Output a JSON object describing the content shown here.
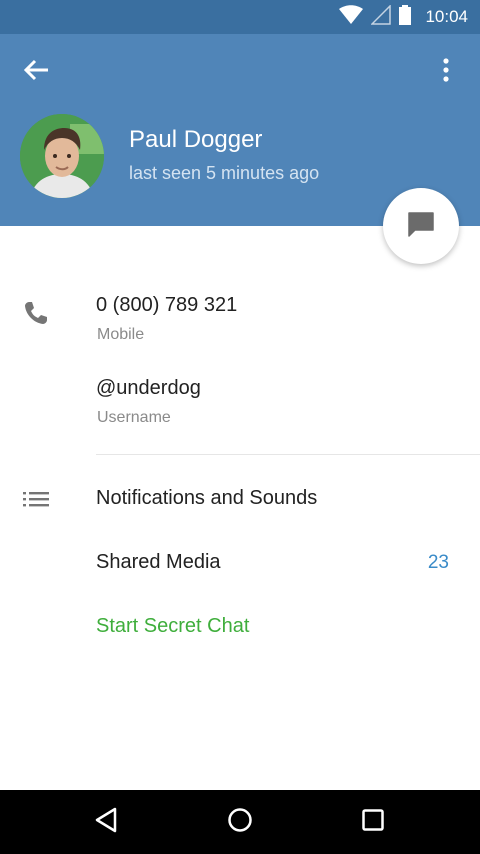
{
  "status_bar": {
    "time": "10:04",
    "icons": [
      "wifi-icon",
      "signal-icon",
      "battery-icon"
    ]
  },
  "header": {
    "back_icon": "arrow-left-icon",
    "menu_icon": "more-vertical-icon",
    "name": "Paul Dogger",
    "last_seen": "last seen 5 minutes ago",
    "header_color": "#5085b8",
    "fab_icon": "message-icon"
  },
  "info": {
    "phone": {
      "value": "0 (800) 789 321",
      "label": "Mobile",
      "icon": "phone-icon"
    },
    "username": {
      "value": "@underdog",
      "label": "Username"
    }
  },
  "settings": {
    "notifications_label": "Notifications and Sounds",
    "notifications_icon": "list-icon",
    "shared_media_label": "Shared Media",
    "shared_media_count": "23",
    "secret_chat_label": "Start Secret Chat",
    "secret_chat_color": "#3fae3c",
    "count_color": "#3a8bc8"
  },
  "nav_bar": {
    "buttons": [
      "back-triangle-icon",
      "home-circle-icon",
      "recents-square-icon"
    ]
  }
}
